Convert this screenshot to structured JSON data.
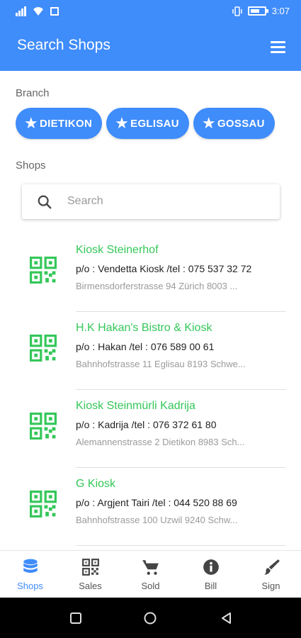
{
  "status_bar": {
    "time": "3:07"
  },
  "header": {
    "title": "Search Shops"
  },
  "branch": {
    "label": "Branch",
    "chips": [
      "DIETIKON",
      "EGLISAU",
      "GOSSAU"
    ]
  },
  "shops_section": {
    "label": "Shops",
    "search_placeholder": "Search"
  },
  "shops": [
    {
      "name": "Kiosk Steinerhof",
      "owner": "p/o : Vendetta Kiosk /tel : 075 537 32 72",
      "address": "Birmensdorferstrasse 94  Zürich 8003 ..."
    },
    {
      "name": "H.K Hakan's Bistro & Kiosk",
      "owner": "p/o : Hakan /tel : 076 589 00 61",
      "address": "Bahnhofstrasse 11  Eglisau 8193 Schwe..."
    },
    {
      "name": "Kiosk Steinmürli Kadrija",
      "owner": "p/o : Kadrija /tel : 076 372 61 80",
      "address": "Alemannenstrasse 2  Dietikon 8983 Sch..."
    },
    {
      "name": "G Kiosk",
      "owner": "p/o : Argjent Tairi /tel : 044 520 88 69",
      "address": "Bahnhofstrasse 100  Uzwil 9240  Schw..."
    }
  ],
  "bottom_nav": [
    {
      "label": "Shops",
      "icon": "database-icon",
      "active": true
    },
    {
      "label": "Sales",
      "icon": "qr-code-icon",
      "active": false
    },
    {
      "label": "Sold",
      "icon": "cart-icon",
      "active": false
    },
    {
      "label": "Bill",
      "icon": "info-icon",
      "active": false
    },
    {
      "label": "Sign",
      "icon": "brush-icon",
      "active": false
    }
  ],
  "colors": {
    "primary": "#3f8cfb",
    "shop_name": "#34c759",
    "qr": "#34c759"
  }
}
